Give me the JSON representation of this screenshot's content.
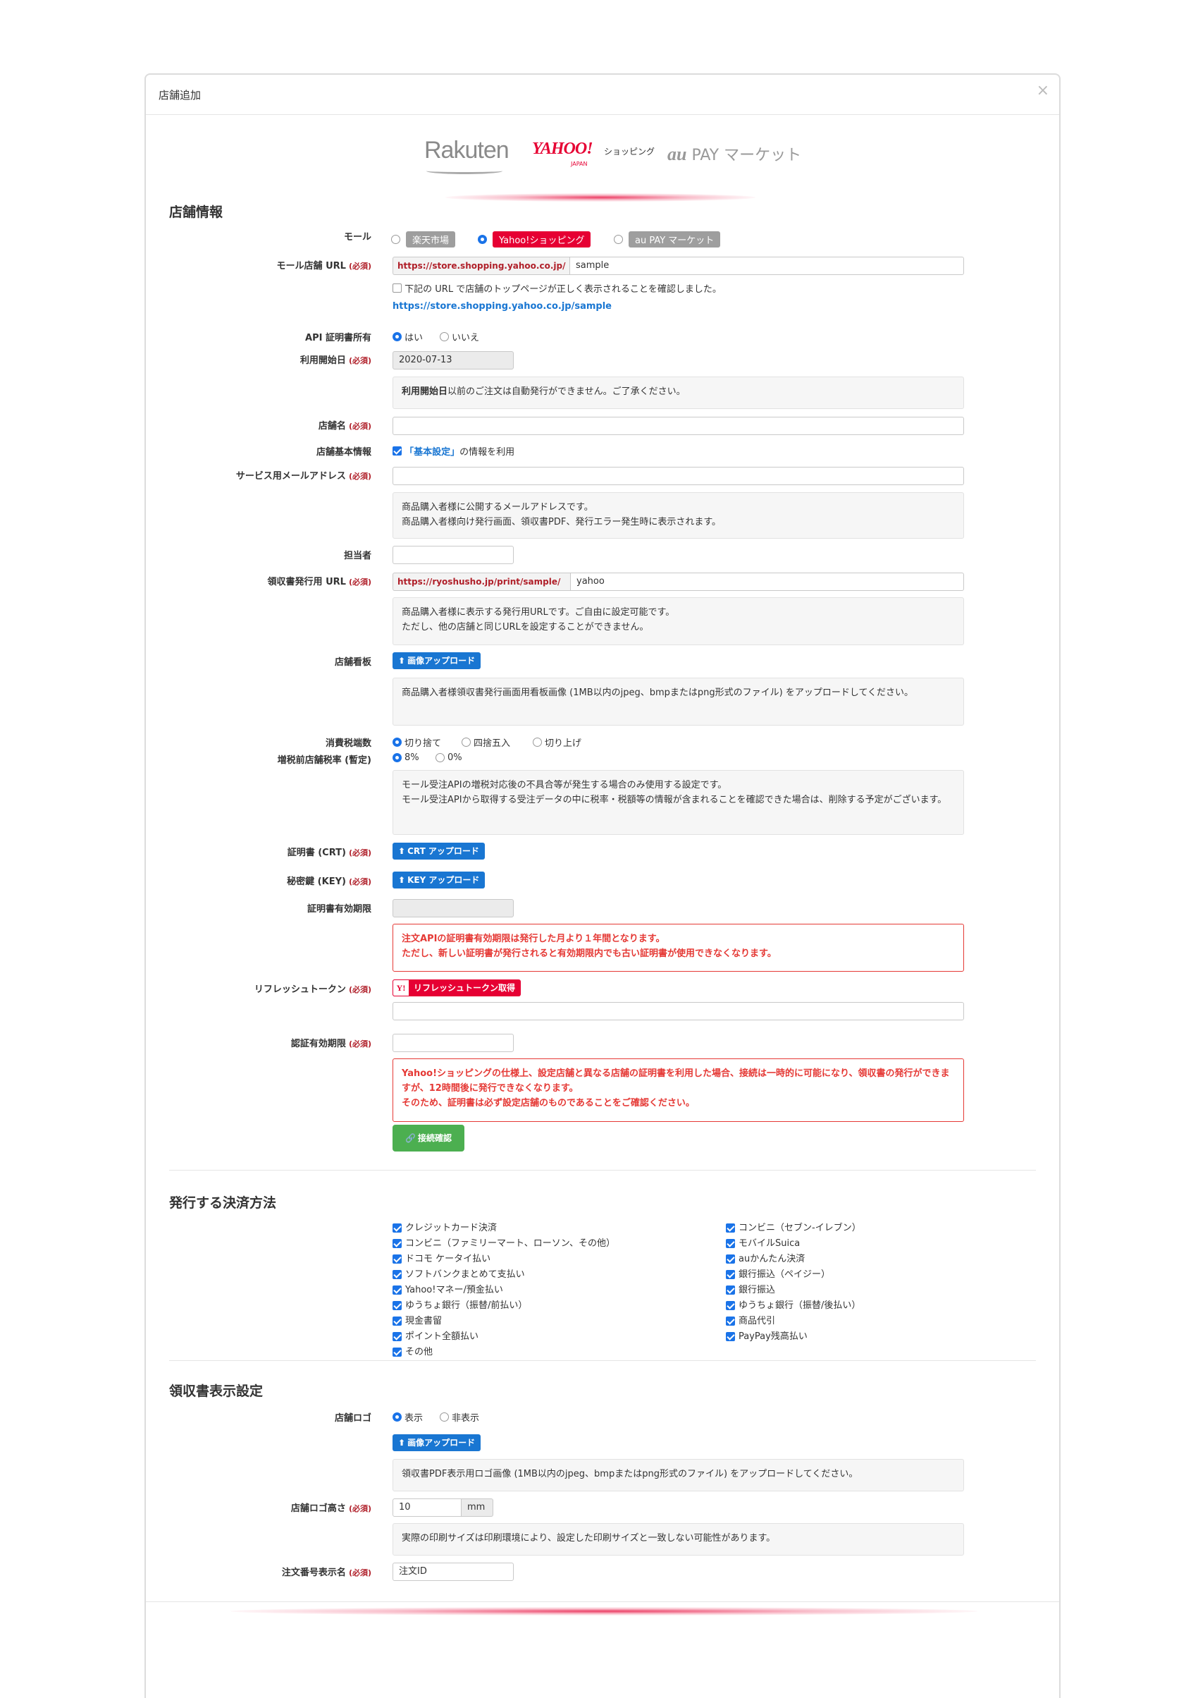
{
  "dialog": {
    "title": "店舗追加",
    "close": "×"
  },
  "logos": {
    "rakuten": "Rakuten",
    "yahoo": "YAHOO!",
    "yahoo_japan": "JAPAN",
    "yahoo_shopping": "ショッピング",
    "au": "au",
    "aupay": "PAY マーケット"
  },
  "sections": {
    "store_info": "店舗情報",
    "payment": "発行する決済方法",
    "receipt": "領収書表示設定"
  },
  "required": "(必須)",
  "mall": {
    "label": "モール",
    "options": [
      "楽天市場",
      "Yahoo!ショッピング",
      "au PAY マーケット"
    ],
    "selected": "Yahoo!ショッピング"
  },
  "mall_url": {
    "label": "モール店舗 URL",
    "prefix": "https://store.shopping.yahoo.co.jp/",
    "value": "sample",
    "confirm_text": "下記の URL で店舗のトップページが正しく表示されることを確認しました。",
    "link": "https://store.shopping.yahoo.co.jp/sample"
  },
  "api_cert": {
    "label": "API 証明書所有",
    "options": [
      "はい",
      "いいえ"
    ],
    "selected": "はい"
  },
  "start_date": {
    "label": "利用開始日",
    "value": "2020-07-13",
    "note_bold": "利用開始日",
    "note_rest": "以前のご注文は自動発行ができません。ご了承ください。"
  },
  "store_name": {
    "label": "店舗名",
    "value": ""
  },
  "basic_info": {
    "label": "店舗基本情報",
    "link_text": "「基本設定」",
    "rest": "の情報を利用",
    "checked": true
  },
  "service_email": {
    "label": "サービス用メールアドレス",
    "value": "",
    "note": "商品購入者様に公開するメールアドレスです。\n商品購入者様向け発行画面、領収書PDF、発行エラー発生時に表示されます。"
  },
  "person": {
    "label": "担当者",
    "value": ""
  },
  "receipt_url": {
    "label": "領収書発行用 URL",
    "prefix": "https://ryoshusho.jp/print/sample/",
    "value": "yahoo",
    "note": "商品購入者様に表示する発行用URLです。ご自由に設定可能です。\nただし、他の店舗と同じURLを設定することができません。"
  },
  "signboard": {
    "label": "店舗看板",
    "button": "画像アップロード",
    "note": "商品購入者様領収書発行画面用看板画像 (1MB以内のjpeg、bmpまたはpng形式のファイル) をアップロードしてください。"
  },
  "tax_rounding": {
    "label": "消費税端数",
    "options": [
      "切り捨て",
      "四捨五入",
      "切り上げ"
    ],
    "selected": "切り捨て"
  },
  "tax_rate": {
    "label": "増税前店舗税率 (暫定)",
    "options": [
      "8%",
      "0%"
    ],
    "selected": "8%",
    "note": "モール受注APIの増税対応後の不具合等が発生する場合のみ使用する設定です。\nモール受注APIから取得する受注データの中に税率・税額等の情報が含まれることを確認できた場合は、削除する予定がございます。"
  },
  "crt": {
    "label": "証明書 (CRT)",
    "button": "CRT アップロード"
  },
  "key": {
    "label": "秘密鍵 (KEY)",
    "button": "KEY アップロード"
  },
  "cert_expiry": {
    "label": "証明書有効期限",
    "value": "",
    "note": "注文APIの証明書有効期限は発行した月より１年間となります。\nただし、新しい証明書が発行されると有効期限内でも古い証明書が使用できなくなります。"
  },
  "refresh_token": {
    "label": "リフレッシュトークン",
    "button": "リフレッシュトークン取得",
    "icon_letter": "Y!",
    "value": ""
  },
  "auth_expiry": {
    "label": "認証有効期限",
    "value": "",
    "note": "Yahoo!ショッピングの仕様上、設定店舗と異なる店舗の証明書を利用した場合、接続は一時的に可能になり、領収書の発行ができますが、12時間後に発行できなくなります。\nそのため、証明書は必ず設定店舗のものであることをご確認ください。"
  },
  "connect_button": "接続確認",
  "payments": {
    "left": [
      "クレジットカード決済",
      "コンビニ（ファミリーマート、ローソン、その他）",
      "ドコモ ケータイ払い",
      "ソフトバンクまとめて支払い",
      "Yahoo!マネー/預金払い",
      "ゆうちょ銀行（振替/前払い）",
      "現金書留",
      "ポイント全額払い",
      "その他"
    ],
    "right": [
      "コンビニ（セブン-イレブン）",
      "モバイルSuica",
      "auかんたん決済",
      "銀行振込（ペイジー）",
      "銀行振込",
      "ゆうちょ銀行（振替/後払い）",
      "商品代引",
      "PayPay残高払い"
    ]
  },
  "logo_display": {
    "label": "店舗ロゴ",
    "options": [
      "表示",
      "非表示"
    ],
    "selected": "表示",
    "button": "画像アップロード",
    "note": "領収書PDF表示用ロゴ画像 (1MB以内のjpeg、bmpまたはpng形式のファイル) をアップロードしてください。"
  },
  "logo_height": {
    "label": "店舗ロゴ高さ",
    "value": "10",
    "unit": "mm",
    "note": "実際の印刷サイズは印刷環境により、設定した印刷サイズと一致しない可能性があります。"
  },
  "order_label": {
    "label": "注文番号表示名",
    "value": "注文ID"
  },
  "colors": {
    "accent": "#1976d2",
    "required": "#b0202a",
    "yahoo": "#e60033",
    "success": "#4caf50",
    "error": "#e53935"
  }
}
